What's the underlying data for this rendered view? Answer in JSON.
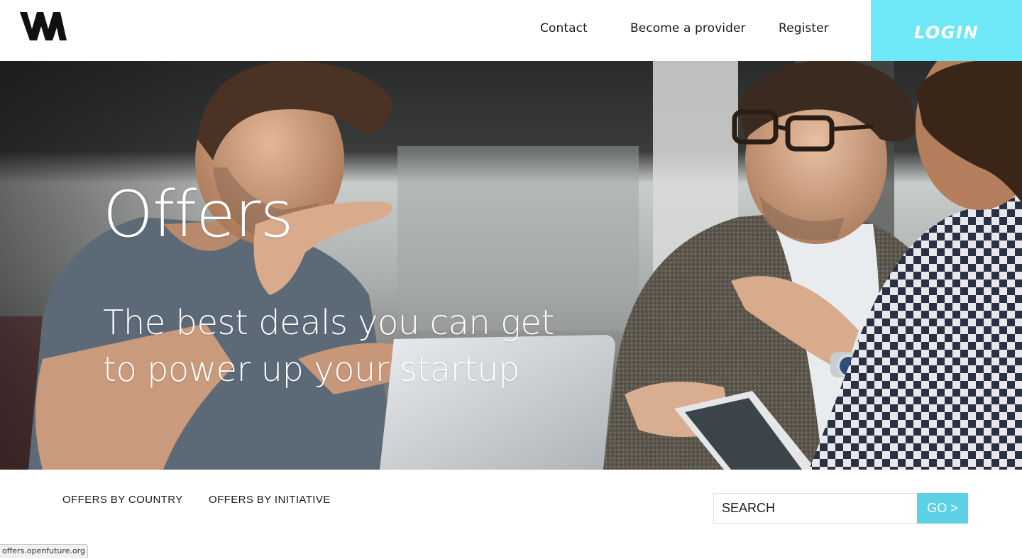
{
  "header": {
    "logo_name": "wm-logo",
    "nav": {
      "contact": "Contact",
      "become_provider": "Become a provider",
      "register": "Register"
    },
    "login_label": "LOGIN"
  },
  "hero": {
    "title": "Offers",
    "subtitle": "The best deals you can get to power up your startup",
    "image": "photo of three men in business meeting with laptop and tablet"
  },
  "filters": {
    "by_country": "OFFERS BY COUNTRY",
    "by_initiative": "OFFERS BY INITIATIVE"
  },
  "search": {
    "placeholder": "SEARCH",
    "go_label": "GO >"
  },
  "status_bar": {
    "url": "offers.openfuture.org"
  },
  "colors": {
    "accent": "#6ee8f6",
    "go_button": "#5cd0e4"
  }
}
